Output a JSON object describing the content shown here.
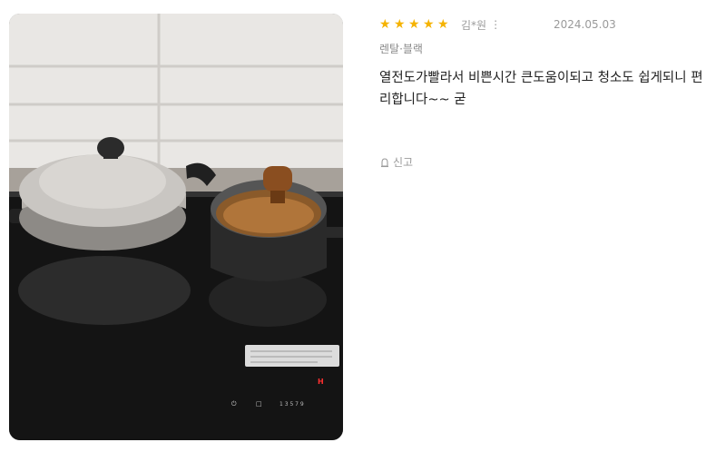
{
  "review": {
    "rating": 5,
    "stars": [
      "★",
      "★",
      "★",
      "★",
      "★"
    ],
    "author": "김*원",
    "more_icon": "⋮",
    "date": "2024.05.03",
    "option": "렌탈·블랙",
    "text": "열전도가빨라서 비쁜시간 큰도움이되고 청소도 쉽게되니 편리합니다~~ 굳",
    "report_label": "신고"
  },
  "photo": {
    "panel_labels": [
      "전원",
      "잠금",
      "1",
      "2",
      "3",
      "4",
      "5",
      "6",
      "7",
      "8",
      "9"
    ],
    "stove_indicator": "H"
  },
  "colors": {
    "star": "#f5b301",
    "muted_text": "#9a9a9a",
    "body_text": "#222222"
  }
}
